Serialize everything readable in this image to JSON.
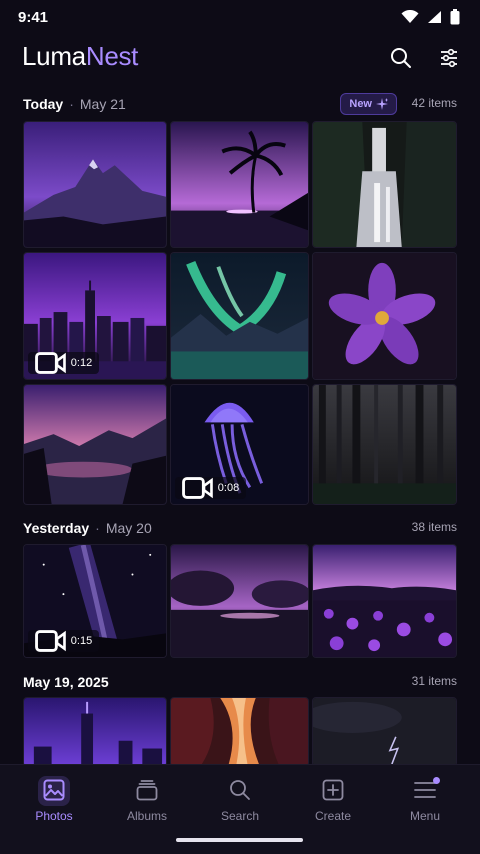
{
  "status": {
    "time": "9:41"
  },
  "app": {
    "title_part1": "Luma",
    "title_part2": "Nest"
  },
  "sections": [
    {
      "title": "Today",
      "subtitle": "May 21",
      "badge": "New",
      "count": "42 items"
    },
    {
      "title": "Yesterday",
      "subtitle": "May 20",
      "count": "38 items"
    },
    {
      "title": "May 19, 2025",
      "count": "31 items"
    }
  ],
  "videos": {
    "city": "0:12",
    "jellyfish": "0:08",
    "milkyway": "0:15"
  },
  "nav": {
    "photos": "Photos",
    "albums": "Albums",
    "search": "Search",
    "create": "Create",
    "menu": "Menu"
  },
  "colors": {
    "accent": "#a98cff",
    "background": "#0d0b16",
    "nav_background": "#12101d"
  }
}
